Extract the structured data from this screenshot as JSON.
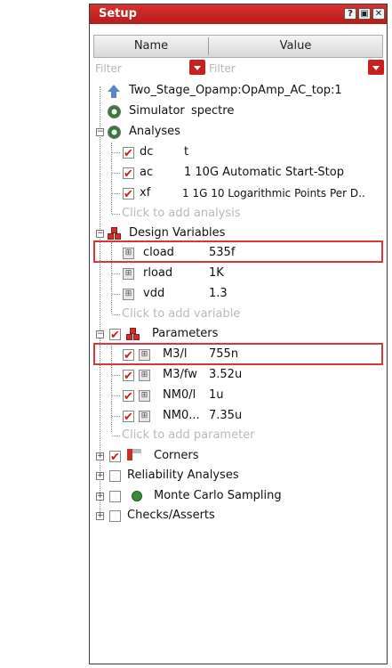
{
  "window": {
    "title": "Setup"
  },
  "columns": {
    "name": "Name",
    "value": "Value"
  },
  "filter": {
    "name_placeholder": "Filter",
    "value_placeholder": "Filter"
  },
  "tree": {
    "testbench": "Two_Stage_Opamp:OpAmp_AC_top:1",
    "simulator": {
      "label": "Simulator",
      "value": "spectre"
    },
    "analyses": {
      "label": "Analyses",
      "items": [
        {
          "name": "dc",
          "value": "t"
        },
        {
          "name": "ac",
          "value": "1 10G Automatic Start-Stop"
        },
        {
          "name": "xf",
          "value": "1 1G 10 Logarithmic Points Per D.."
        }
      ],
      "add_hint": "Click to add analysis"
    },
    "design_variables": {
      "label": "Design Variables",
      "items": [
        {
          "name": "cload",
          "value": "535f"
        },
        {
          "name": "rload",
          "value": "1K"
        },
        {
          "name": "vdd",
          "value": "1.3"
        }
      ],
      "add_hint": "Click to add variable"
    },
    "parameters": {
      "label": "Parameters",
      "items": [
        {
          "name": "M3/l",
          "value": "755n"
        },
        {
          "name": "M3/fw",
          "value": "3.52u"
        },
        {
          "name": "NM0/l",
          "value": "1u"
        },
        {
          "name": "NM0...",
          "value": "7.35u"
        }
      ],
      "add_hint": "Click to add parameter"
    },
    "corners": "Corners",
    "reliability": "Reliability Analyses",
    "monte_carlo": "Monte Carlo Sampling",
    "checks": "Checks/Asserts"
  },
  "colors": {
    "accent": "#c8201e",
    "highlight_border": "#d8343a"
  }
}
